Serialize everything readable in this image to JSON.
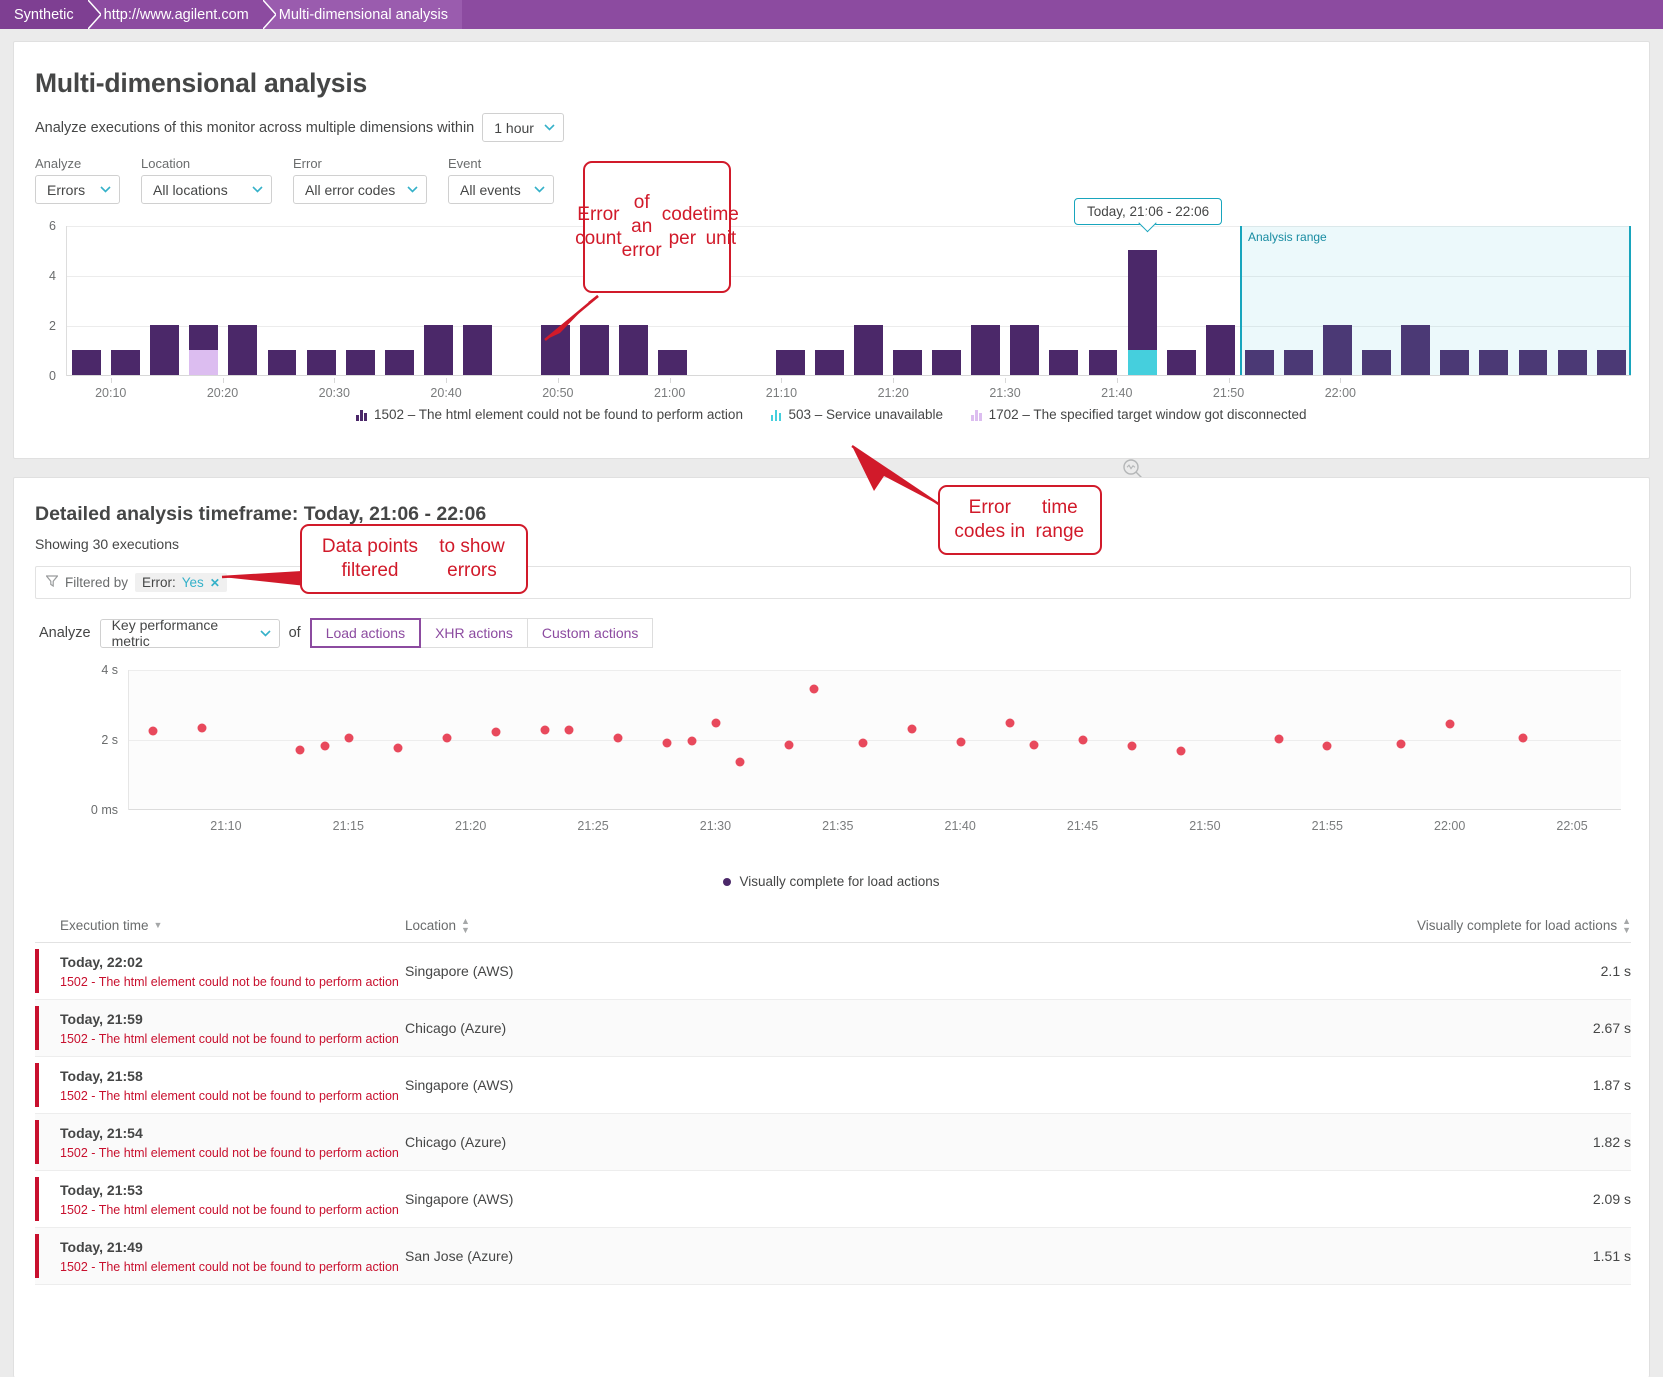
{
  "breadcrumb": {
    "items": [
      "Synthetic",
      "http://www.agilent.com",
      "Multi-dimensional analysis"
    ]
  },
  "header": {
    "title": "Multi-dimensional analysis",
    "subline_prefix": "Analyze executions of this monitor across multiple dimensions within",
    "timeframe_value": "1 hour"
  },
  "filters": [
    {
      "label": "Analyze",
      "value": "Errors"
    },
    {
      "label": "Location",
      "value": "All locations"
    },
    {
      "label": "Error",
      "value": "All error codes"
    },
    {
      "label": "Event",
      "value": "All events"
    }
  ],
  "top_chart": {
    "range_label": "Analysis range",
    "range_tooltip": "Today, 21:06 - 22:06"
  },
  "detail": {
    "title": "Detailed analysis timeframe: Today, 21:06 - 22:06",
    "showing": "Showing 30 executions",
    "filtered_by_label": "Filtered by",
    "chip_key": "Error:",
    "chip_value": "Yes",
    "chip_close": "✕",
    "analyze_label": "Analyze",
    "metric_value": "Key performance metric",
    "of_label": "of",
    "action_tabs": [
      {
        "label": "Load actions",
        "active": true
      },
      {
        "label": "XHR actions",
        "active": false
      },
      {
        "label": "Custom actions",
        "active": false
      }
    ]
  },
  "table": {
    "headers": [
      "Execution time",
      "Location",
      "Visually complete for load actions"
    ],
    "rows": [
      {
        "time": "Today, 22:02",
        "error": "1502 - The html element could not be found to perform action",
        "location": "Singapore (AWS)",
        "value": "2.1 s"
      },
      {
        "time": "Today, 21:59",
        "error": "1502 - The html element could not be found to perform action",
        "location": "Chicago (Azure)",
        "value": "2.67 s"
      },
      {
        "time": "Today, 21:58",
        "error": "1502 - The html element could not be found to perform action",
        "location": "Singapore (AWS)",
        "value": "1.87 s"
      },
      {
        "time": "Today, 21:54",
        "error": "1502 - The html element could not be found to perform action",
        "location": "Chicago (Azure)",
        "value": "1.82 s"
      },
      {
        "time": "Today, 21:53",
        "error": "1502 - The html element could not be found to perform action",
        "location": "Singapore (AWS)",
        "value": "2.09 s"
      },
      {
        "time": "Today, 21:49",
        "error": "1502 - The html element could not be found to perform action",
        "location": "San Jose (Azure)",
        "value": "1.51 s"
      }
    ]
  },
  "annotations": [
    {
      "id": "a1",
      "text": "Error count\nof an error\ncode per\ntime unit"
    },
    {
      "id": "a2",
      "text": "Error codes in\ntime range"
    },
    {
      "id": "a3",
      "text": "Data points filtered\nto show errors"
    }
  ],
  "colors": {
    "brand_purple": "#8c4ba0",
    "bar_purple": "#4b2869",
    "bar_cyan": "#45cfdd",
    "bar_lilac": "#dcbdf0",
    "error_red": "#c8102e",
    "dot_red": "#e8495c",
    "teal": "#18a5bd",
    "annotation_red": "#d11a2a"
  },
  "chart_data": [
    {
      "type": "bar",
      "title": "",
      "xlabel": "",
      "ylabel": "",
      "ylim": [
        0,
        6
      ],
      "yticks": [
        0,
        2,
        4,
        6
      ],
      "grid": true,
      "stacked": true,
      "bar_interval_minutes": 2,
      "x_start": "20:06",
      "xticks": [
        "20:10",
        "20:20",
        "20:30",
        "20:40",
        "20:50",
        "21:00",
        "21:10",
        "21:20",
        "21:30",
        "21:40",
        "21:50",
        "22:00"
      ],
      "legend_position": "bottom",
      "series": [
        {
          "name": "1502 – The html element could not be found to perform action",
          "color": "#4b2869",
          "values": [
            1,
            1,
            2,
            1,
            2,
            1,
            1,
            1,
            1,
            2,
            2,
            0,
            2,
            2,
            2,
            1,
            0,
            0,
            1,
            1,
            2,
            1,
            1,
            2,
            2,
            1,
            1,
            4,
            1,
            2,
            1,
            1,
            2,
            1,
            2,
            1,
            1,
            1,
            1,
            1
          ]
        },
        {
          "name": "503 – Service unavailable",
          "color": "#45cfdd",
          "values": [
            0,
            0,
            0,
            0,
            0,
            0,
            0,
            0,
            0,
            0,
            0,
            0,
            0,
            0,
            0,
            0,
            0,
            0,
            0,
            0,
            0,
            0,
            0,
            0,
            0,
            0,
            0,
            1,
            0,
            0,
            0,
            0,
            0,
            0,
            0,
            0,
            0,
            0,
            0,
            0
          ]
        },
        {
          "name": "1702 – The specified target window got disconnected",
          "color": "#dcbdf0",
          "values": [
            0,
            0,
            0,
            1,
            0,
            0,
            0,
            0,
            0,
            0,
            0,
            0,
            0,
            0,
            0,
            0,
            0,
            0,
            0,
            0,
            0,
            0,
            0,
            0,
            0,
            0,
            0,
            0,
            0,
            0,
            0,
            0,
            0,
            0,
            0,
            0,
            0,
            0,
            0,
            0
          ]
        }
      ],
      "analysis_range": {
        "label": "Analysis range",
        "tooltip": "Today, 21:06 - 22:06",
        "start": "21:06",
        "end": "22:06"
      }
    },
    {
      "type": "scatter",
      "title": "",
      "xlabel": "",
      "ylabel": "",
      "ylim": [
        0,
        4
      ],
      "yticks": [
        "0 ms",
        "2 s",
        "4 s"
      ],
      "grid": true,
      "xticks": [
        "21:10",
        "21:15",
        "21:20",
        "21:25",
        "21:30",
        "21:35",
        "21:40",
        "21:45",
        "21:50",
        "21:55",
        "22:00",
        "22:05"
      ],
      "legend_position": "bottom",
      "series": [
        {
          "name": "Visually complete for load actions",
          "color": "#e8495c",
          "points": [
            {
              "x": "21:07",
              "y": 2.27
            },
            {
              "x": "21:09",
              "y": 2.33
            },
            {
              "x": "21:13",
              "y": 1.72
            },
            {
              "x": "21:14",
              "y": 1.83
            },
            {
              "x": "21:15",
              "y": 2.07
            },
            {
              "x": "21:17",
              "y": 1.78
            },
            {
              "x": "21:19",
              "y": 2.05
            },
            {
              "x": "21:21",
              "y": 2.22
            },
            {
              "x": "21:23",
              "y": 2.3
            },
            {
              "x": "21:24",
              "y": 2.3
            },
            {
              "x": "21:26",
              "y": 2.06
            },
            {
              "x": "21:28",
              "y": 1.91
            },
            {
              "x": "21:29",
              "y": 1.96
            },
            {
              "x": "21:30",
              "y": 2.5
            },
            {
              "x": "21:31",
              "y": 1.38
            },
            {
              "x": "21:33",
              "y": 1.86
            },
            {
              "x": "21:34",
              "y": 3.45
            },
            {
              "x": "21:36",
              "y": 1.92
            },
            {
              "x": "21:38",
              "y": 2.32
            },
            {
              "x": "21:40",
              "y": 1.93
            },
            {
              "x": "21:42",
              "y": 2.48
            },
            {
              "x": "21:43",
              "y": 1.86
            },
            {
              "x": "21:45",
              "y": 2.0
            },
            {
              "x": "21:47",
              "y": 1.82
            },
            {
              "x": "21:49",
              "y": 1.68
            },
            {
              "x": "21:53",
              "y": 2.03
            },
            {
              "x": "21:55",
              "y": 1.82
            },
            {
              "x": "21:58",
              "y": 1.89
            },
            {
              "x": "22:00",
              "y": 2.45
            },
            {
              "x": "22:03",
              "y": 2.05
            }
          ]
        }
      ]
    }
  ]
}
